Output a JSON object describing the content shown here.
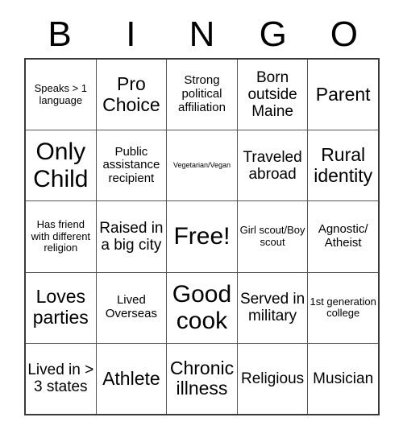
{
  "card": {
    "header_letters": [
      "B",
      "I",
      "N",
      "G",
      "O"
    ],
    "rows": [
      [
        {
          "text": "Speaks > 1 language",
          "size": "sm"
        },
        {
          "text": "Pro Choice",
          "size": "xl"
        },
        {
          "text": "Strong political affiliation",
          "size": "md"
        },
        {
          "text": "Born outside Maine",
          "size": "lg"
        },
        {
          "text": "Parent",
          "size": "xl"
        }
      ],
      [
        {
          "text": "Only Child",
          "size": "xxl"
        },
        {
          "text": "Public assistance recipient",
          "size": "md"
        },
        {
          "text": "Vegetarian/Vegan",
          "size": "xs"
        },
        {
          "text": "Traveled abroad",
          "size": "lg"
        },
        {
          "text": "Rural identity",
          "size": "xl"
        }
      ],
      [
        {
          "text": "Has friend with different religion",
          "size": "sm"
        },
        {
          "text": "Raised in a big city",
          "size": "lg"
        },
        {
          "text": "Free!",
          "size": "xxl"
        },
        {
          "text": "Girl scout/Boy scout",
          "size": "sm"
        },
        {
          "text": "Agnostic/ Atheist",
          "size": "md"
        }
      ],
      [
        {
          "text": "Loves parties",
          "size": "xl"
        },
        {
          "text": "Lived Overseas",
          "size": "md"
        },
        {
          "text": "Good cook",
          "size": "xxl"
        },
        {
          "text": "Served in military",
          "size": "lg"
        },
        {
          "text": "1st generation college",
          "size": "sm"
        }
      ],
      [
        {
          "text": "Lived in > 3 states",
          "size": "lg"
        },
        {
          "text": "Athlete",
          "size": "xl"
        },
        {
          "text": "Chronic illness",
          "size": "xl"
        },
        {
          "text": "Religious",
          "size": "lg"
        },
        {
          "text": "Musician",
          "size": "lg"
        }
      ]
    ]
  }
}
